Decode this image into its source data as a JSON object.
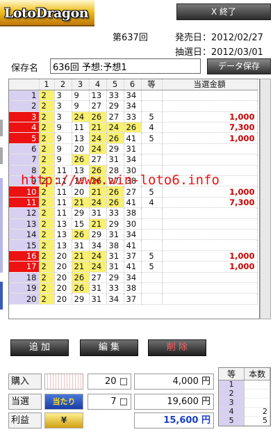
{
  "app": {
    "logo_text": "LotoDragon",
    "exit_label": "X 終了"
  },
  "header": {
    "draw_no": "第637回",
    "release_label": "発売日：",
    "release_date": "2012/02/27",
    "lottery_label": "抽選日：",
    "lottery_date": "2012/03/01"
  },
  "save": {
    "label": "保存名",
    "value": "636回 予想:予想1",
    "button": "データ保存"
  },
  "grid": {
    "columns": [
      "",
      "1",
      "2",
      "3",
      "4",
      "5",
      "6",
      "等",
      "当選金額"
    ],
    "rows": [
      {
        "idx": "1",
        "nums": [
          "2",
          "3",
          "9",
          "13",
          "33",
          "34"
        ],
        "hits": [
          0
        ],
        "rank": "",
        "amount": "",
        "win": false
      },
      {
        "idx": "2",
        "nums": [
          "2",
          "3",
          "9",
          "27",
          "29",
          "34"
        ],
        "hits": [
          0
        ],
        "rank": "",
        "amount": "",
        "win": false
      },
      {
        "idx": "3",
        "nums": [
          "2",
          "3",
          "24",
          "26",
          "27",
          "33"
        ],
        "hits": [
          0,
          2,
          3
        ],
        "rank": "5",
        "amount": "1,000",
        "win": true
      },
      {
        "idx": "4",
        "nums": [
          "2",
          "9",
          "11",
          "21",
          "24",
          "26"
        ],
        "hits": [
          0,
          3,
          4,
          5
        ],
        "rank": "4",
        "amount": "7,300",
        "win": true
      },
      {
        "idx": "5",
        "nums": [
          "2",
          "9",
          "13",
          "24",
          "26",
          "41"
        ],
        "hits": [
          0,
          3,
          4
        ],
        "rank": "5",
        "amount": "1,000",
        "win": true
      },
      {
        "idx": "6",
        "nums": [
          "2",
          "9",
          "20",
          "24",
          "29",
          "31"
        ],
        "hits": [
          0,
          3
        ],
        "rank": "",
        "amount": "",
        "win": false
      },
      {
        "idx": "7",
        "nums": [
          "2",
          "9",
          "26",
          "27",
          "31",
          "34"
        ],
        "hits": [
          0,
          2
        ],
        "rank": "",
        "amount": "",
        "win": false
      },
      {
        "idx": "8",
        "nums": [
          "2",
          "11",
          "13",
          "26",
          "28",
          "30"
        ],
        "hits": [
          0,
          3
        ],
        "rank": "",
        "amount": "",
        "win": false
      },
      {
        "idx": "9",
        "nums": [
          "2",
          "11",
          "15",
          "26",
          "27",
          "38"
        ],
        "hits": [
          0,
          3
        ],
        "rank": "",
        "amount": "",
        "win": false
      },
      {
        "idx": "10",
        "nums": [
          "2",
          "11",
          "20",
          "21",
          "26",
          "27"
        ],
        "hits": [
          0,
          3,
          4
        ],
        "rank": "5",
        "amount": "1,000",
        "win": true
      },
      {
        "idx": "11",
        "nums": [
          "2",
          "11",
          "21",
          "24",
          "26",
          "41"
        ],
        "hits": [
          0,
          2,
          3,
          4
        ],
        "rank": "4",
        "amount": "7,300",
        "win": true
      },
      {
        "idx": "12",
        "nums": [
          "2",
          "11",
          "29",
          "31",
          "33",
          "38"
        ],
        "hits": [
          0
        ],
        "rank": "",
        "amount": "",
        "win": false
      },
      {
        "idx": "13",
        "nums": [
          "2",
          "13",
          "15",
          "21",
          "29",
          "30"
        ],
        "hits": [
          0,
          3
        ],
        "rank": "",
        "amount": "",
        "win": false
      },
      {
        "idx": "14",
        "nums": [
          "2",
          "13",
          "26",
          "29",
          "31",
          "34"
        ],
        "hits": [
          0,
          2
        ],
        "rank": "",
        "amount": "",
        "win": false
      },
      {
        "idx": "15",
        "nums": [
          "2",
          "13",
          "31",
          "34",
          "38",
          "41"
        ],
        "hits": [
          0
        ],
        "rank": "",
        "amount": "",
        "win": false
      },
      {
        "idx": "16",
        "nums": [
          "2",
          "20",
          "21",
          "24",
          "31",
          "37"
        ],
        "hits": [
          0,
          2,
          3
        ],
        "rank": "5",
        "amount": "1,000",
        "win": true
      },
      {
        "idx": "17",
        "nums": [
          "2",
          "20",
          "21",
          "24",
          "31",
          "41"
        ],
        "hits": [
          0,
          2,
          3
        ],
        "rank": "5",
        "amount": "1,000",
        "win": true
      },
      {
        "idx": "18",
        "nums": [
          "2",
          "20",
          "26",
          "27",
          "29",
          "34"
        ],
        "hits": [
          0,
          2
        ],
        "rank": "",
        "amount": "",
        "win": false
      },
      {
        "idx": "19",
        "nums": [
          "2",
          "20",
          "26",
          "31",
          "33",
          "38"
        ],
        "hits": [
          0,
          2
        ],
        "rank": "",
        "amount": "",
        "win": false
      },
      {
        "idx": "20",
        "nums": [
          "2",
          "20",
          "29",
          "31",
          "34",
          "37"
        ],
        "hits": [
          0
        ],
        "rank": "",
        "amount": "",
        "win": false
      }
    ]
  },
  "watermark": "http://www.win-loto6.info",
  "actions": {
    "add": "追 加",
    "edit": "編 集",
    "delete": "削 除"
  },
  "summary": {
    "buy_label": "購入",
    "buy_count": "20 □",
    "buy_yen": "4,000 円",
    "win_label": "当選",
    "win_icon": "当たり",
    "win_count": "7 □",
    "win_yen": "19,600 円",
    "profit_label": "利益",
    "profit_icon": "¥",
    "profit_yen": "15,600 円"
  },
  "rank_summary": {
    "headers": [
      "等",
      "本数"
    ],
    "rows": [
      {
        "rank": "1",
        "count": ""
      },
      {
        "rank": "2",
        "count": ""
      },
      {
        "rank": "3",
        "count": ""
      },
      {
        "rank": "4",
        "count": "2"
      },
      {
        "rank": "5",
        "count": "5"
      }
    ]
  },
  "colors": {
    "hit": "#f8f070",
    "win_row": "#ee1111",
    "index_bg": "#d8d0f0",
    "amount": "#c80000",
    "profit": "#1a40c8"
  }
}
